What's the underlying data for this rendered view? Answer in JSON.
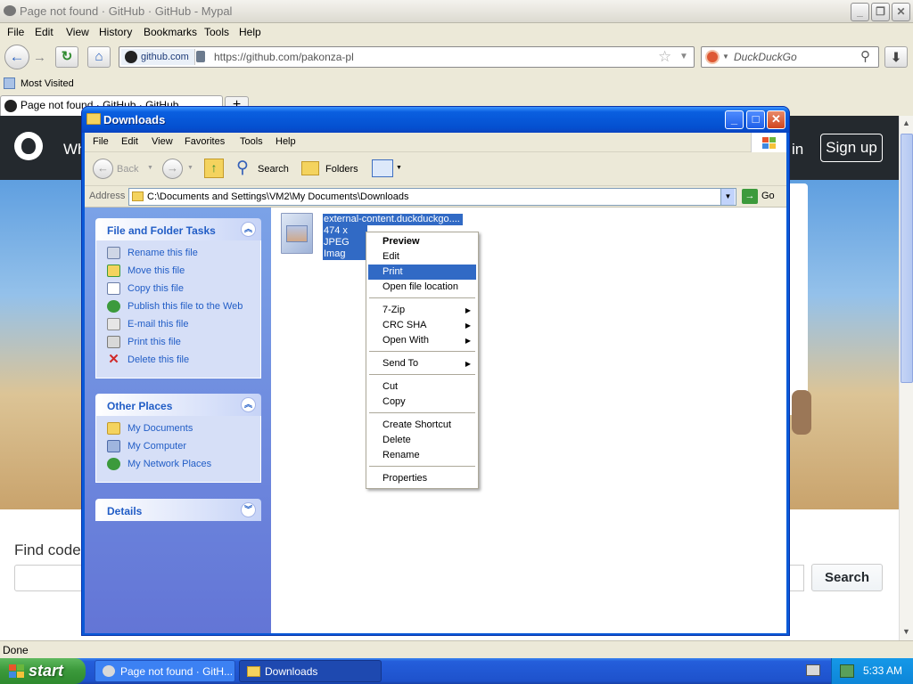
{
  "browser": {
    "title": "Page not found · GitHub · GitHub - Mypal",
    "menu": [
      "File",
      "Edit",
      "View",
      "History",
      "Bookmarks",
      "Tools",
      "Help"
    ],
    "site_identity": "github.com",
    "url": "https://github.com/pakonza-pl",
    "search_placeholder": "DuckDuckGo",
    "bookmark_label": "Most Visited",
    "tab_title": "Page not found · GitHub · GitHub",
    "new_tab_label": "+",
    "status": "Done"
  },
  "github_page": {
    "header_partial_left": "Wh",
    "sign_in_partial": "in",
    "sign_up": "Sign up",
    "find_code": "Find code",
    "search_button": "Search"
  },
  "explorer": {
    "title": "Downloads",
    "menu": [
      "File",
      "Edit",
      "View",
      "Favorites",
      "Tools",
      "Help"
    ],
    "toolbar": {
      "back": "Back",
      "search": "Search",
      "folders": "Folders"
    },
    "address_label": "Address",
    "address": "C:\\Documents and Settings\\VM2\\My Documents\\Downloads",
    "go_label": "Go",
    "panels": {
      "file_tasks": {
        "title": "File and Folder Tasks",
        "items": [
          "Rename this file",
          "Move this file",
          "Copy this file",
          "Publish this file to the Web",
          "E-mail this file",
          "Print this file",
          "Delete this file"
        ]
      },
      "other_places": {
        "title": "Other Places",
        "items": [
          "My Documents",
          "My Computer",
          "My Network Places"
        ]
      },
      "details": {
        "title": "Details"
      }
    },
    "file": {
      "name": "external-content.duckduckgo....",
      "dimensions": "474 x 296",
      "type": "JPEG Imag"
    }
  },
  "context_menu": {
    "items": [
      "Preview",
      "Edit",
      "Print",
      "Open file location",
      "7-Zip",
      "CRC SHA",
      "Open With",
      "Send To",
      "Cut",
      "Copy",
      "Create Shortcut",
      "Delete",
      "Rename",
      "Properties"
    ],
    "selected": "Print"
  },
  "taskbar": {
    "start": "start",
    "tasks": [
      "Page not found · GitH...",
      "Downloads"
    ],
    "clock": "5:33 AM"
  },
  "colors": {
    "xp_blue": "#0a5ad8",
    "selection": "#316ac5",
    "start_green": "#3c9a3c",
    "github_dark": "#24292e"
  }
}
